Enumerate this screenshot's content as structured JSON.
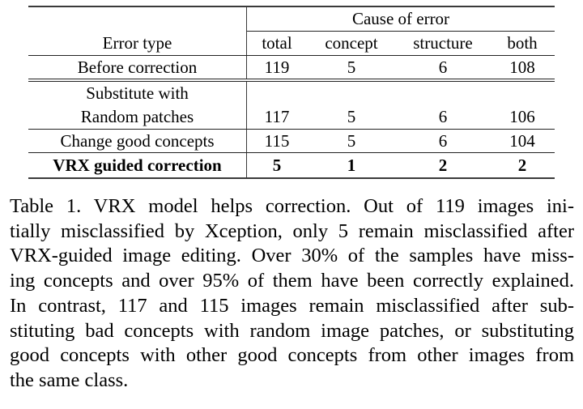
{
  "table": {
    "group_header": "Cause of error",
    "columns": [
      "Error type",
      "total",
      "concept",
      "structure",
      "both"
    ],
    "rows": [
      {
        "label": "Before correction",
        "total": "119",
        "concept": "5",
        "structure": "6",
        "both": "108"
      },
      {
        "label_line1": "Substitute with",
        "label_line2": "Random patches",
        "total": "117",
        "concept": "5",
        "structure": "6",
        "both": "106"
      },
      {
        "label": "Change good concepts",
        "total": "115",
        "concept": "5",
        "structure": "6",
        "both": "104"
      },
      {
        "label": "VRX guided correction",
        "total": "5",
        "concept": "1",
        "structure": "2",
        "both": "2",
        "bold": true
      }
    ]
  },
  "caption": {
    "lines": [
      "Table 1. VRX model helps correction.  Out of 119 images ini-",
      "tially misclassified by Xception, only 5 remain misclassified after",
      "VRX-guided image editing. Over 30% of the samples have miss-",
      "ing concepts and over 95% of them have been correctly explained.",
      "In contrast, 117 and 115 images remain misclassified after sub-",
      "stituting bad concepts with random image patches, or substituting",
      "good concepts with other good concepts from other images from",
      "the same class."
    ]
  }
}
